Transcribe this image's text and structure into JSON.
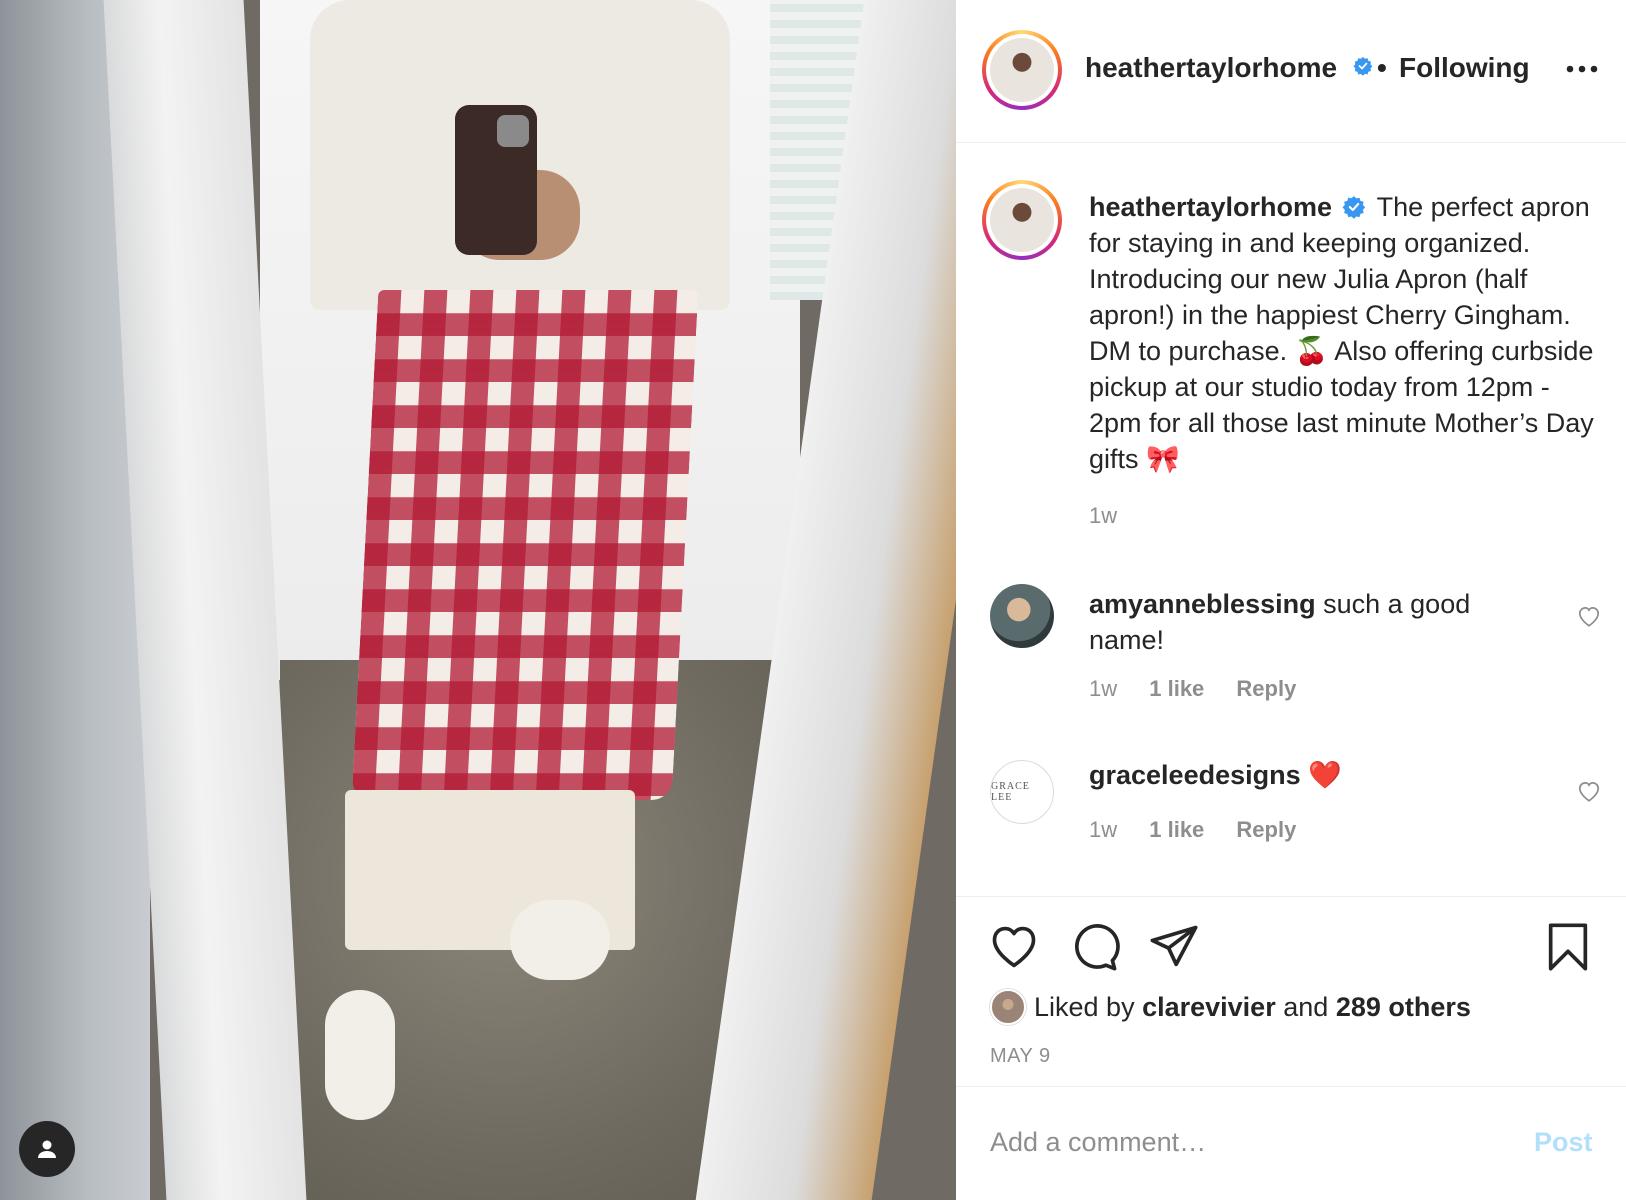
{
  "post": {
    "author": "heathertaylorhome",
    "follow_status": "Following",
    "separator": "•",
    "caption": "The perfect apron for staying in and keeping organized. Introducing our new Julia Apron (half apron!) in the happiest Cherry Gingham. DM to purchase. 🍒 Also offering curbside pickup at our studio today from 12pm - 2pm for all those last minute Mother’s Day gifts 🎀",
    "caption_time": "1w",
    "date": "MAY 9",
    "likes": {
      "prefix": "Liked by",
      "user": "clarevivier",
      "joiner": "and",
      "others": "289 others"
    }
  },
  "comments": [
    {
      "username": "amyanneblessing",
      "text": "such a good name!",
      "time": "1w",
      "likes": "1 like",
      "reply": "Reply"
    },
    {
      "username": "graceleedesigns",
      "text": "❤️",
      "time": "1w",
      "likes": "1 like",
      "reply": "Reply",
      "avatar_text": "GRACE LEE"
    }
  ],
  "add_comment": {
    "placeholder": "Add a comment…",
    "post_label": "Post"
  },
  "colors": {
    "verified_blue": "#3897f0",
    "post_disabled": "#b2dffc",
    "muted_text": "#8e8e8e"
  },
  "icons": {
    "tag": "user-tag-icon",
    "verified": "verified-badge-icon",
    "more": "more-options-icon",
    "like": "heart-icon",
    "comment": "comment-icon",
    "share": "share-icon",
    "save": "bookmark-icon"
  }
}
